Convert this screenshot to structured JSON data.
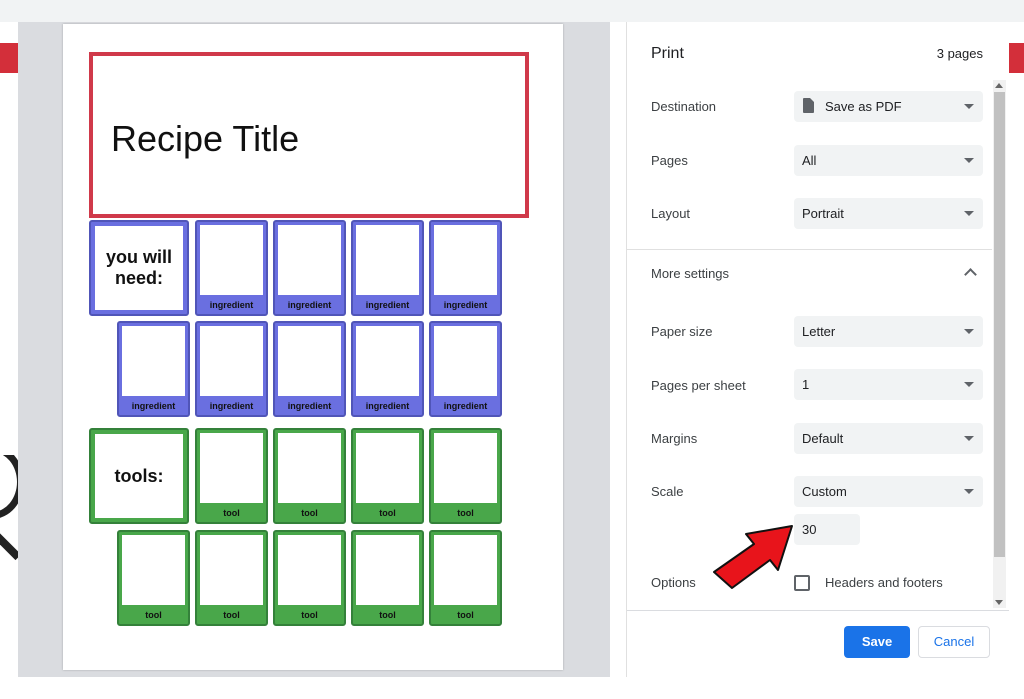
{
  "preview": {
    "recipe_title": "Recipe Title",
    "ingredients_heading": "you will need:",
    "ingredient_label": "ingredient",
    "tools_heading": "tools:",
    "tool_label": "tool",
    "colors": {
      "title_border": "#d0394a",
      "ingredient_card": "#6a6fe0",
      "tool_card": "#49a74a"
    }
  },
  "print": {
    "title": "Print",
    "page_count": "3 pages",
    "destination": {
      "label": "Destination",
      "value": "Save as PDF"
    },
    "pages": {
      "label": "Pages",
      "value": "All"
    },
    "layout": {
      "label": "Layout",
      "value": "Portrait"
    },
    "more_settings": "More settings",
    "paper_size": {
      "label": "Paper size",
      "value": "Letter"
    },
    "pages_per_sheet": {
      "label": "Pages per sheet",
      "value": "1"
    },
    "margins": {
      "label": "Margins",
      "value": "Default"
    },
    "scale": {
      "label": "Scale",
      "value": "Custom",
      "custom_value": "30"
    },
    "options": {
      "label": "Options",
      "headers_footers": "Headers and footers",
      "headers_footers_checked": false
    },
    "save_label": "Save",
    "cancel_label": "Cancel",
    "colors": {
      "accent": "#1a73e8",
      "annotation_arrow": "#e8141b"
    }
  }
}
